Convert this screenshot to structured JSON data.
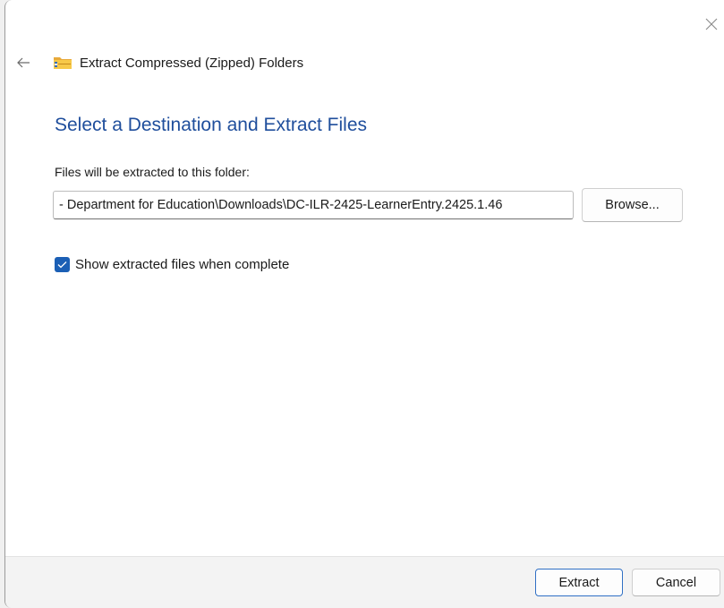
{
  "window": {
    "title": "Extract Compressed (Zipped) Folders",
    "close_icon": "close-icon",
    "back_icon": "back-arrow-icon",
    "app_icon": "zipped-folder-icon"
  },
  "main": {
    "heading": "Select a Destination and Extract Files",
    "destination_label": "Files will be extracted to this folder:",
    "destination_path": "- Department for Education\\Downloads\\DC-ILR-2425-LearnerEntry.2425.1.46",
    "browse_label": "Browse...",
    "show_files_checked": true,
    "show_files_label": "Show extracted files when complete"
  },
  "footer": {
    "extract_label": "Extract",
    "cancel_label": "Cancel"
  },
  "colors": {
    "accent": "#1b5fb5",
    "heading": "#1f4e9c"
  }
}
